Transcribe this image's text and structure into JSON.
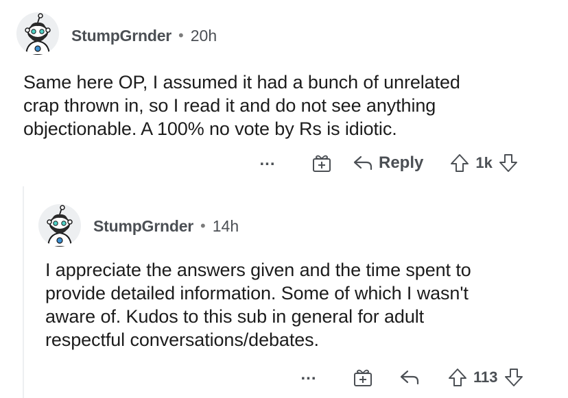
{
  "comments": [
    {
      "username": "StumpGrnder",
      "separator": "•",
      "time": "20h",
      "body": "Same here OP, I assumed it had a bunch of unrelated\ncrap thrown in, so I read  it and do not see anything\nobjectionable. A 100% no vote by Rs is idiotic.",
      "more_label": "...",
      "reply_label": "Reply",
      "vote_count": "1k"
    },
    {
      "username": "StumpGrnder",
      "separator": "•",
      "time": "14h",
      "body": "I appreciate the answers given and the time spent to\nprovide detailed information. Some of which I wasn't\naware of. Kudos to this sub in general for adult\nrespectful conversations/debates.",
      "more_label": "...",
      "reply_label": "",
      "vote_count": "113"
    }
  ],
  "icons": {
    "avatar": "snoo-avatar-icon",
    "award": "gift-award-icon",
    "reply": "reply-arrow-icon",
    "upvote": "upvote-arrow-icon",
    "downvote": "downvote-arrow-icon"
  },
  "colors": {
    "text": "#1c1c1c",
    "meta": "#4b4f54",
    "avatar_bg": "#edeff1",
    "thread_line": "#edeff1"
  }
}
